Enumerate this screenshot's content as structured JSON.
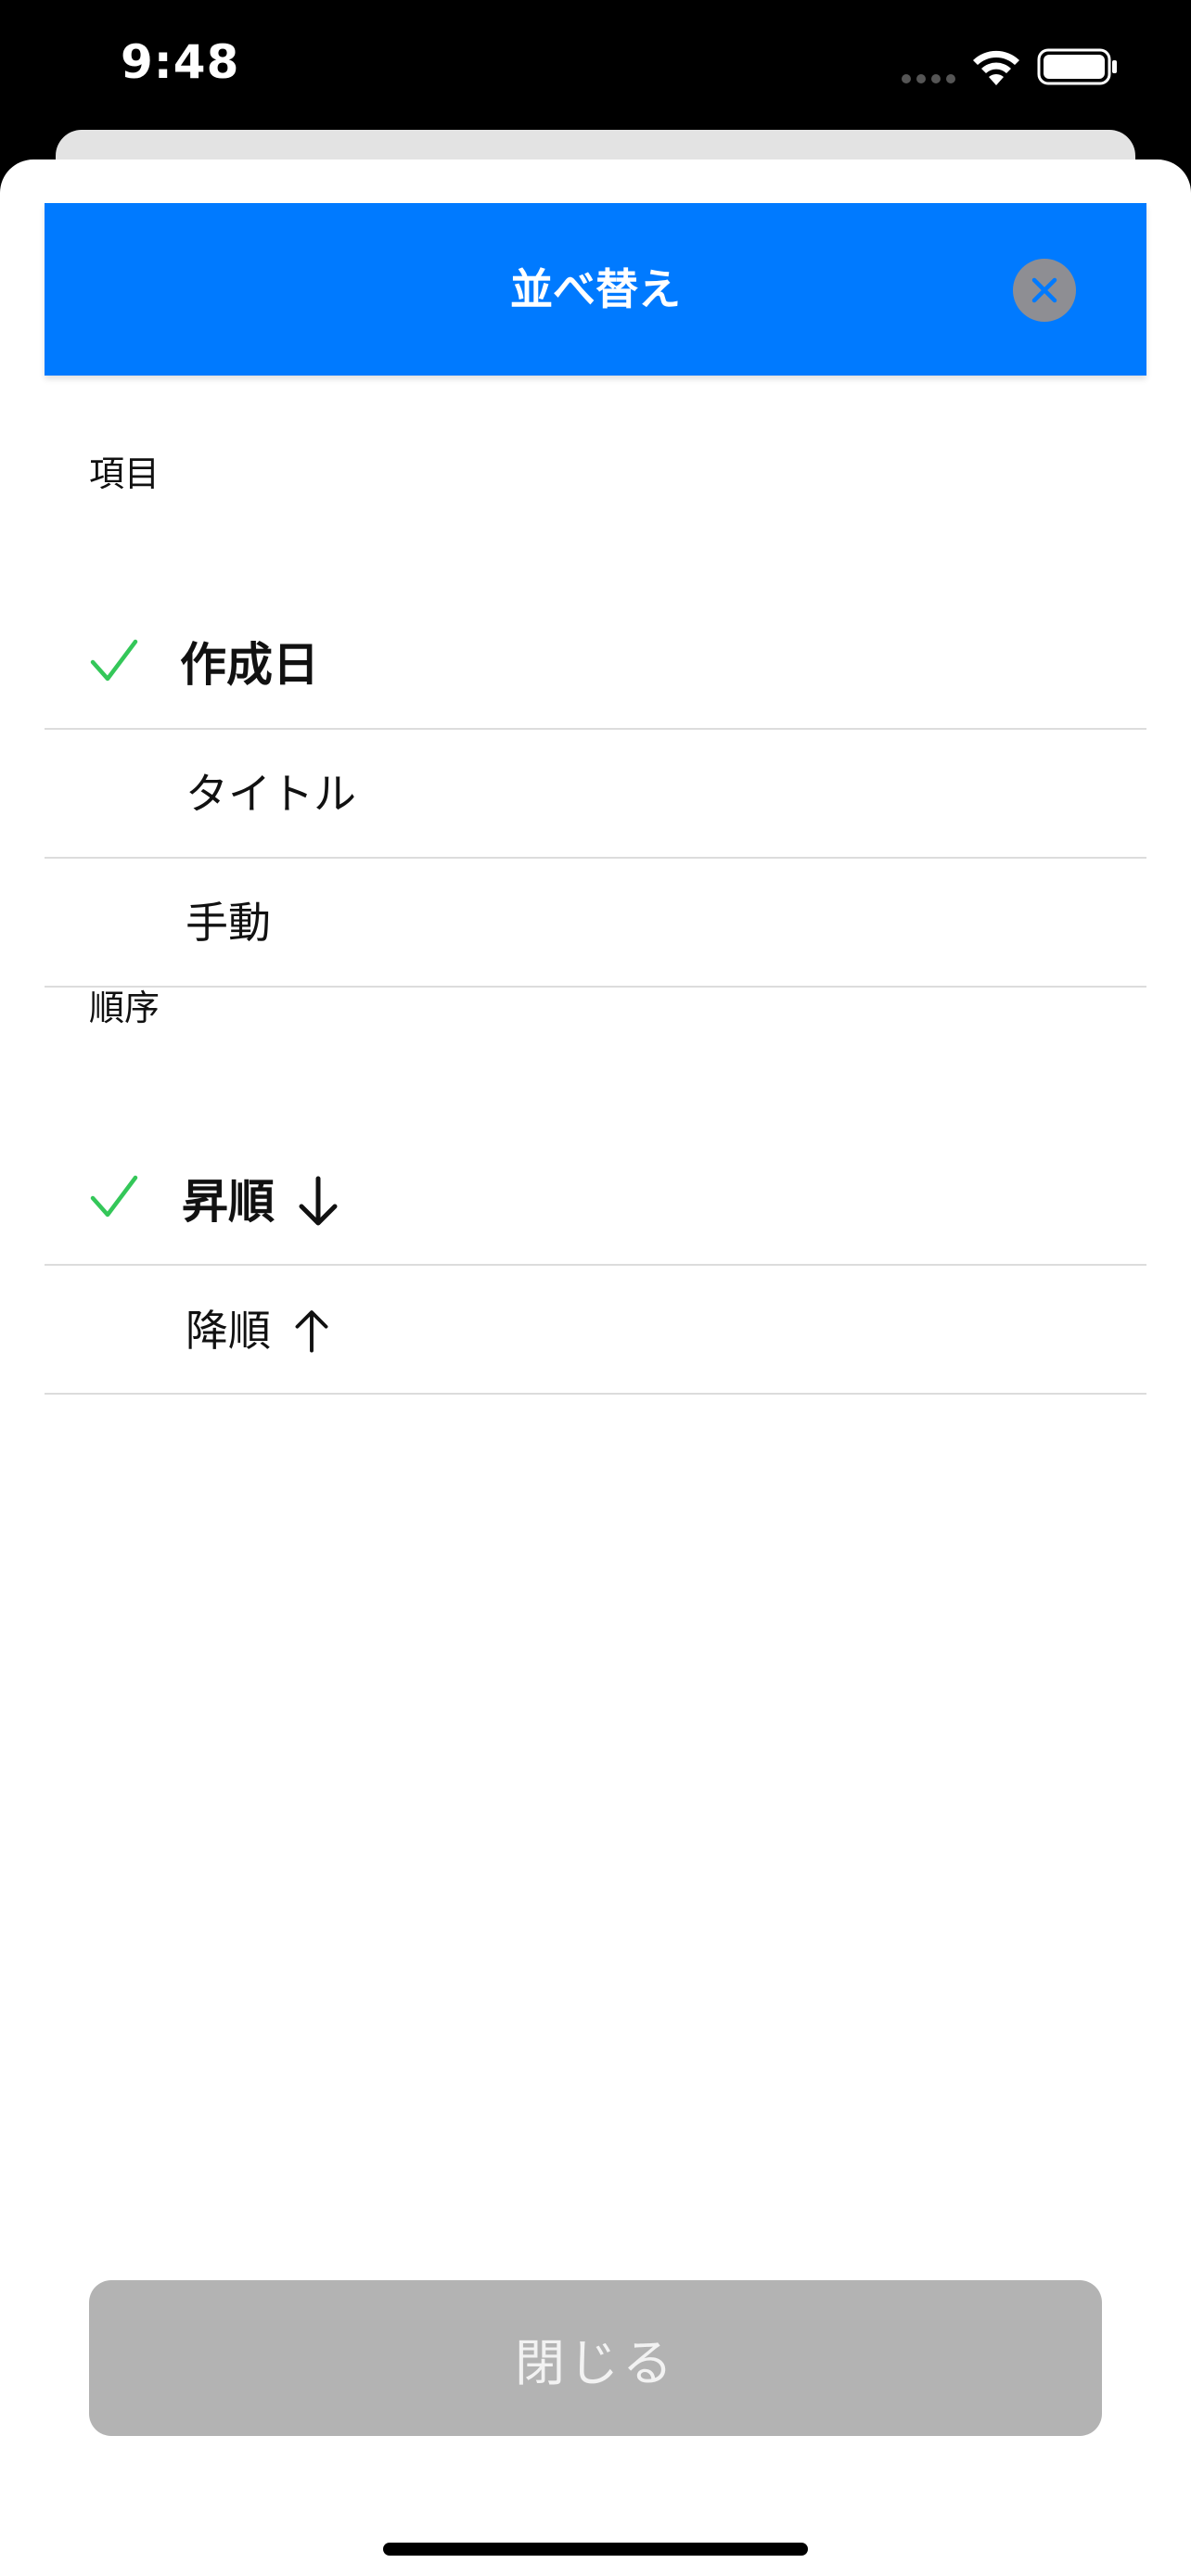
{
  "status_bar": {
    "time": "9:48"
  },
  "sheet": {
    "title": "並べ替え",
    "close_label": "閉じる"
  },
  "sections": {
    "item": {
      "label": "項目",
      "options": [
        {
          "label": "作成日",
          "selected": true
        },
        {
          "label": "タイトル",
          "selected": false
        },
        {
          "label": "手動",
          "selected": false
        }
      ]
    },
    "order": {
      "label": "順序",
      "options": [
        {
          "label": "昇順",
          "selected": true,
          "arrow": "arrow-down-icon"
        },
        {
          "label": "降順",
          "selected": false,
          "arrow": "arrow-up-icon"
        }
      ]
    }
  },
  "colors": {
    "header_bg": "#007aff",
    "check": "#34c759",
    "close_button_bg": "#b3b3b3",
    "close_icon": "#007aff"
  }
}
